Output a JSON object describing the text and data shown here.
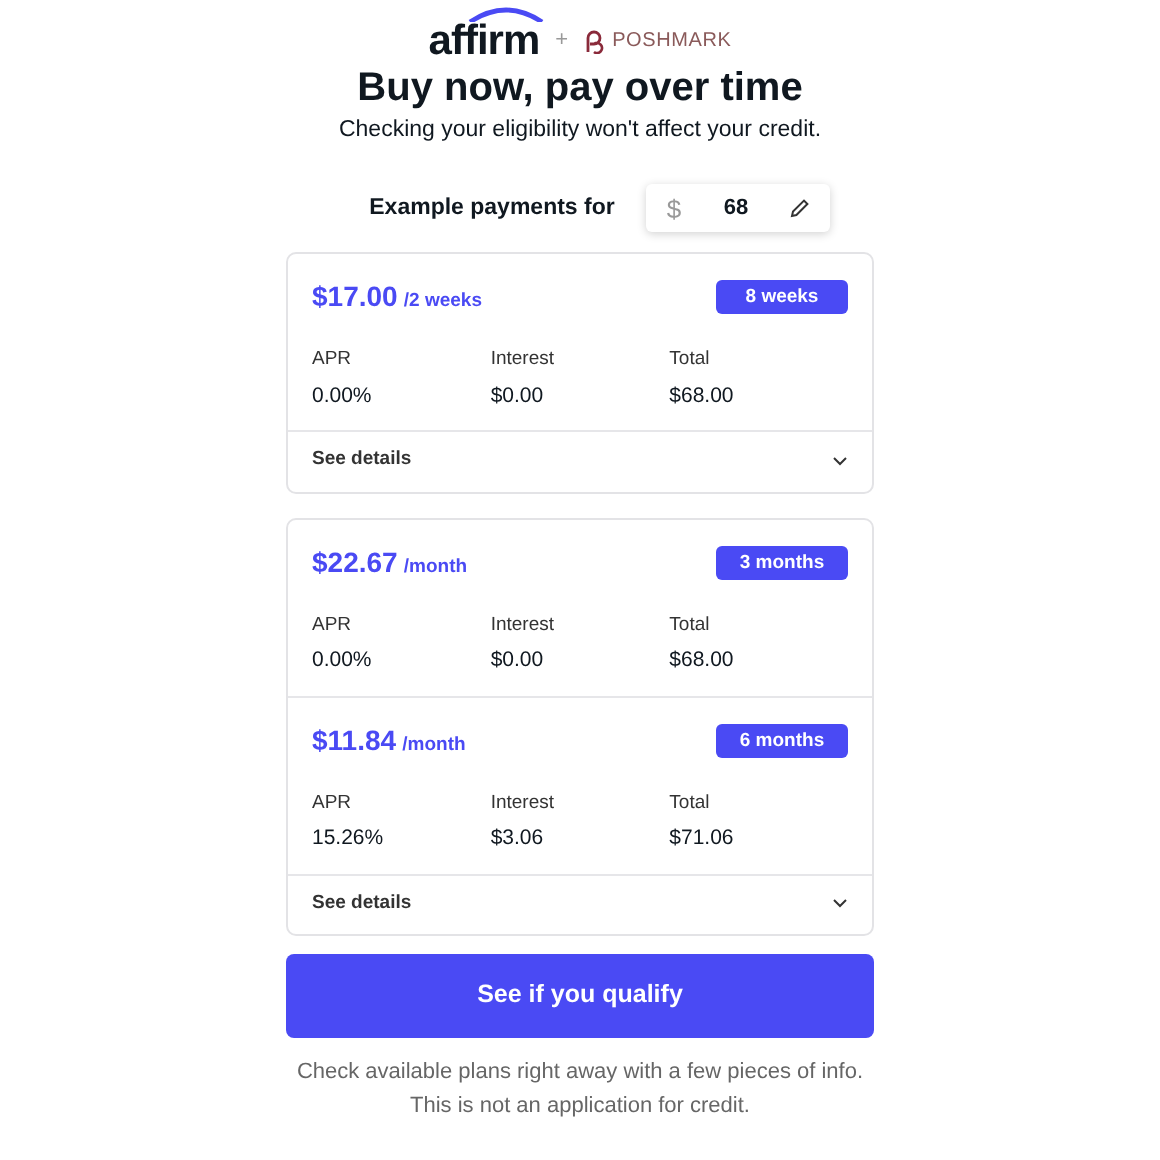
{
  "header": {
    "brand": "affirm",
    "plus": "+",
    "partner": "POSHMARK"
  },
  "title": "Buy now, pay over time",
  "subtitle": "Checking your eligibility won't affect your credit.",
  "amount": {
    "label": "Example payments for",
    "currency": "$",
    "value": "68"
  },
  "cards": [
    {
      "plans": [
        {
          "price": "$17.00",
          "period": "/2 weeks",
          "term": "8 weeks",
          "stats": [
            {
              "label": "APR",
              "value": "0.00%"
            },
            {
              "label": "Interest",
              "value": "$0.00"
            },
            {
              "label": "Total",
              "value": "$68.00"
            }
          ]
        }
      ],
      "details": "See details"
    },
    {
      "plans": [
        {
          "price": "$22.67",
          "period": "/month",
          "term": "3 months",
          "stats": [
            {
              "label": "APR",
              "value": "0.00%"
            },
            {
              "label": "Interest",
              "value": "$0.00"
            },
            {
              "label": "Total",
              "value": "$68.00"
            }
          ]
        },
        {
          "price": "$11.84",
          "period": "/month",
          "term": "6 months",
          "stats": [
            {
              "label": "APR",
              "value": "15.26%"
            },
            {
              "label": "Interest",
              "value": "$3.06"
            },
            {
              "label": "Total",
              "value": "$71.06"
            }
          ]
        }
      ],
      "details": "See details"
    }
  ],
  "cta": "See if you qualify",
  "footer": [
    "Check available plans right away with a few pieces of info.",
    "This is not an application for credit."
  ]
}
